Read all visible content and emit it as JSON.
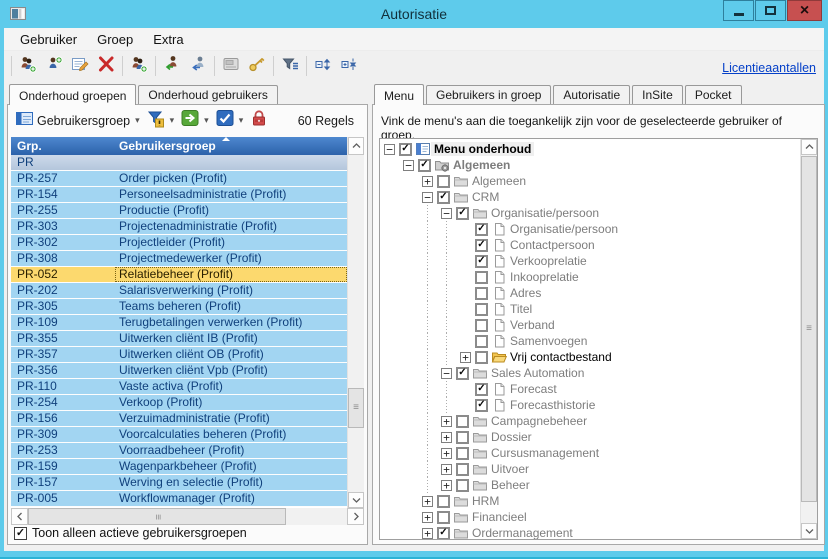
{
  "window": {
    "title": "Autorisatie",
    "controls": [
      "minimize",
      "maximize",
      "close"
    ]
  },
  "menubar": {
    "items": [
      "Gebruiker",
      "Groep",
      "Extra"
    ]
  },
  "main_toolbar": {
    "link_label": "Licentieaantallen",
    "groups": [
      [
        "add-users-group-icon",
        "add-user-icon",
        "properties-icon",
        "delete-icon"
      ],
      [
        "copy-group-icon"
      ],
      [
        "user-into-group-icon",
        "user-out-of-group-icon"
      ],
      [
        "preview-icon",
        "authorization-key-icon"
      ],
      [
        "filter-icon"
      ],
      [
        "expand-all-icon",
        "collapse-all-icon"
      ]
    ]
  },
  "left_panel": {
    "tabs": [
      {
        "label": "Onderhoud groepen",
        "active": true
      },
      {
        "label": "Onderhoud gebruikers",
        "active": false
      }
    ],
    "toolbar": {
      "items": [
        {
          "icon": "view-grid-icon",
          "label": "Gebruikersgroep",
          "caret": true
        },
        {
          "icon": "filter-warning-icon",
          "caret": true
        },
        {
          "icon": "go-arrow-icon",
          "caret": true
        },
        {
          "icon": "check-icon",
          "caret": true
        },
        {
          "icon": "lock-icon",
          "caret": false
        }
      ],
      "row_count_label": "60 Regels"
    },
    "grid": {
      "columns": [
        "Grp.",
        "Gebruikersgroep"
      ],
      "rows": [
        {
          "code": "PR",
          "name": "",
          "group": true
        },
        {
          "code": "PR-257",
          "name": "Order picken (Profit)"
        },
        {
          "code": "PR-154",
          "name": "Personeelsadministratie (Profit)"
        },
        {
          "code": "PR-255",
          "name": "Productie (Profit)"
        },
        {
          "code": "PR-303",
          "name": "Projectenadministratie (Profit)"
        },
        {
          "code": "PR-302",
          "name": "Projectleider (Profit)"
        },
        {
          "code": "PR-308",
          "name": "Projectmedewerker (Profit)"
        },
        {
          "code": "PR-052",
          "name": "Relatiebeheer (Profit)",
          "selected": true
        },
        {
          "code": "PR-202",
          "name": "Salarisverwerking (Profit)"
        },
        {
          "code": "PR-305",
          "name": "Teams beheren (Profit)"
        },
        {
          "code": "PR-109",
          "name": "Terugbetalingen verwerken (Profit)"
        },
        {
          "code": "PR-355",
          "name": "Uitwerken cliënt IB (Profit)"
        },
        {
          "code": "PR-357",
          "name": "Uitwerken cliënt OB (Profit)"
        },
        {
          "code": "PR-356",
          "name": "Uitwerken cliënt Vpb (Profit)"
        },
        {
          "code": "PR-110",
          "name": "Vaste activa (Profit)"
        },
        {
          "code": "PR-254",
          "name": "Verkoop (Profit)"
        },
        {
          "code": "PR-156",
          "name": "Verzuimadministratie (Profit)"
        },
        {
          "code": "PR-309",
          "name": "Voorcalculaties beheren (Profit)"
        },
        {
          "code": "PR-253",
          "name": "Voorraadbeheer (Profit)"
        },
        {
          "code": "PR-159",
          "name": "Wagenparkbeheer (Profit)"
        },
        {
          "code": "PR-157",
          "name": "Werving en selectie (Profit)"
        },
        {
          "code": "PR-005",
          "name": "Workflowmanager (Profit)"
        }
      ]
    },
    "footer": {
      "checkbox_label": "Toon alleen actieve gebruikersgroepen",
      "checked": true
    }
  },
  "right_panel": {
    "tabs": [
      {
        "label": "Menu",
        "active": true
      },
      {
        "label": "Gebruikers in groep",
        "active": false
      },
      {
        "label": "Autorisatie",
        "active": false
      },
      {
        "label": "InSite",
        "active": false
      },
      {
        "label": "Pocket",
        "active": false
      }
    ],
    "instruction": "Vink de menu's aan die toegankelijk zijn voor de geselecteerde gebruiker of groep.",
    "tree": [
      {
        "label": "Menu onderhoud",
        "level": 0,
        "expander": "minus",
        "checked": true,
        "icon": "menu-root-icon",
        "style": "root"
      },
      {
        "label": "Algemeen",
        "level": 1,
        "expander": "minus",
        "checked": true,
        "icon": "gear-folder-icon",
        "style": "bold-gray"
      },
      {
        "label": "Algemeen",
        "level": 2,
        "expander": "plus",
        "checked": false,
        "icon": "folder-icon"
      },
      {
        "label": "CRM",
        "level": 2,
        "expander": "minus",
        "checked": true,
        "icon": "folder-icon"
      },
      {
        "label": "Organisatie/persoon",
        "level": 3,
        "expander": "minus",
        "checked": true,
        "icon": "folder-icon"
      },
      {
        "label": "Organisatie/persoon",
        "level": 4,
        "checked": true,
        "icon": "page-icon"
      },
      {
        "label": "Contactpersoon",
        "level": 4,
        "checked": true,
        "icon": "page-icon"
      },
      {
        "label": "Verkooprelatie",
        "level": 4,
        "checked": true,
        "icon": "page-icon"
      },
      {
        "label": "Inkooprelatie",
        "level": 4,
        "checked": false,
        "icon": "page-icon"
      },
      {
        "label": "Adres",
        "level": 4,
        "checked": false,
        "icon": "page-icon"
      },
      {
        "label": "Titel",
        "level": 4,
        "checked": false,
        "icon": "page-icon"
      },
      {
        "label": "Verband",
        "level": 4,
        "checked": false,
        "icon": "page-icon"
      },
      {
        "label": "Samenvoegen",
        "level": 4,
        "checked": false,
        "icon": "page-icon"
      },
      {
        "label": "Vrij contactbestand",
        "level": 4,
        "expander": "plus",
        "checked": false,
        "icon": "folder-open-yellow-icon",
        "style": "black"
      },
      {
        "label": "Sales Automation",
        "level": 3,
        "expander": "minus",
        "checked": true,
        "icon": "folder-icon"
      },
      {
        "label": "Forecast",
        "level": 4,
        "checked": true,
        "icon": "page-icon"
      },
      {
        "label": "Forecasthistorie",
        "level": 4,
        "checked": true,
        "icon": "page-icon"
      },
      {
        "label": "Campagnebeheer",
        "level": 3,
        "expander": "plus",
        "checked": false,
        "icon": "folder-icon"
      },
      {
        "label": "Dossier",
        "level": 3,
        "expander": "plus",
        "checked": false,
        "icon": "folder-icon"
      },
      {
        "label": "Cursusmanagement",
        "level": 3,
        "expander": "plus",
        "checked": false,
        "icon": "folder-icon"
      },
      {
        "label": "Uitvoer",
        "level": 3,
        "expander": "plus",
        "checked": false,
        "icon": "folder-icon"
      },
      {
        "label": "Beheer",
        "level": 3,
        "expander": "plus",
        "checked": false,
        "icon": "folder-icon"
      },
      {
        "label": "HRM",
        "level": 2,
        "expander": "plus",
        "checked": false,
        "icon": "folder-icon"
      },
      {
        "label": "Financieel",
        "level": 2,
        "expander": "plus",
        "checked": false,
        "icon": "folder-icon"
      },
      {
        "label": "Ordermanagement",
        "level": 2,
        "expander": "plus",
        "checked": true,
        "icon": "folder-icon"
      }
    ]
  },
  "colors": {
    "titlebar": "#5ecbeb",
    "close_button": "#c75050",
    "grid_header": "#3a76c4",
    "row_background": "#a2d5f2",
    "row_text": "#10407c",
    "selected_row_background": "#fcd96e",
    "link": "#0540c8"
  }
}
